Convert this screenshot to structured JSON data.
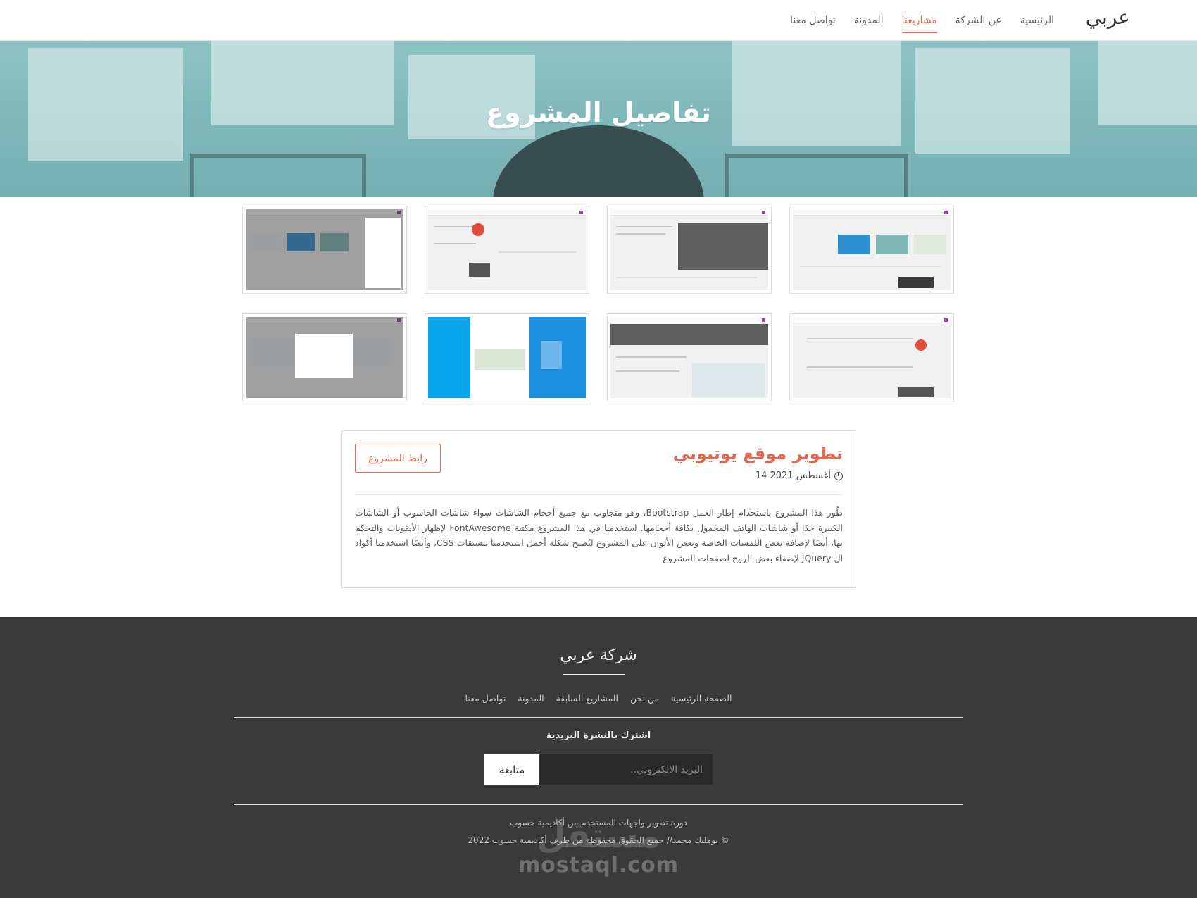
{
  "nav": {
    "brand": "عربي",
    "items": [
      {
        "label": "الرئيسية"
      },
      {
        "label": "عن الشركة"
      },
      {
        "label": "مشاريعنا"
      },
      {
        "label": "المدونة"
      },
      {
        "label": "تواصل معنا"
      }
    ],
    "active": "مشاريعنا"
  },
  "hero": {
    "title": "تفاصيل المشروع"
  },
  "gallery": {
    "thumbnails": [
      "",
      "",
      "",
      "",
      "",
      "",
      "",
      ""
    ]
  },
  "project": {
    "title": "تطوير موقع يوتيوبي",
    "date": "14 أغسطس 2021",
    "link_label": "رابط المشروع",
    "description": "طُور هذا المشروع باستخدام إطار العمل Bootstrap، وهو متجاوب مع جميع أحجام الشاشات سواء شاشات الحاسوب أو الشاشات الكبيرة جدًا أو شاشات الهاتف المحمول بكافة أحجامها. استخدمنا في هذا المشروع مكتبة FontAwesome لإظهار الأيقونات والتحكم بها، أيضًا لإضافة بعض اللمسات الخاصة وبعض الألوان على المشروع ليُصبح شكله أجمل استخدمنا تنسيقات CSS، وأيضًا استخدمنا أكواد ال JQuery لإضفاء بعض الروح لصفحات المشروع"
  },
  "footer": {
    "title": "شركة عربي",
    "links": [
      {
        "label": "الصفحة الرئيسية"
      },
      {
        "label": "من نحن"
      },
      {
        "label": "المشاريع السابقة"
      },
      {
        "label": "المدونة"
      },
      {
        "label": "تواصل معنا"
      }
    ],
    "subscribe_label": "اشترك بالنشرة البريدية",
    "email_placeholder": "البريد الالكتروني..",
    "subscribe_button": "متابعة",
    "credit_line1": "دورة تطوير واجهات المستخدم من أكاديمية حسوب",
    "credit_line2": "بومليك محمد// جميع الحقوق محفوظة من طرف أكاديمية حسوب 2022 ©",
    "watermark_ar": "مستقل",
    "watermark": "mostaql.com"
  },
  "colors": {
    "accent": "#e5674f",
    "footer_bg": "#3a3a3a",
    "hero_tint": "#7fb8ba"
  }
}
